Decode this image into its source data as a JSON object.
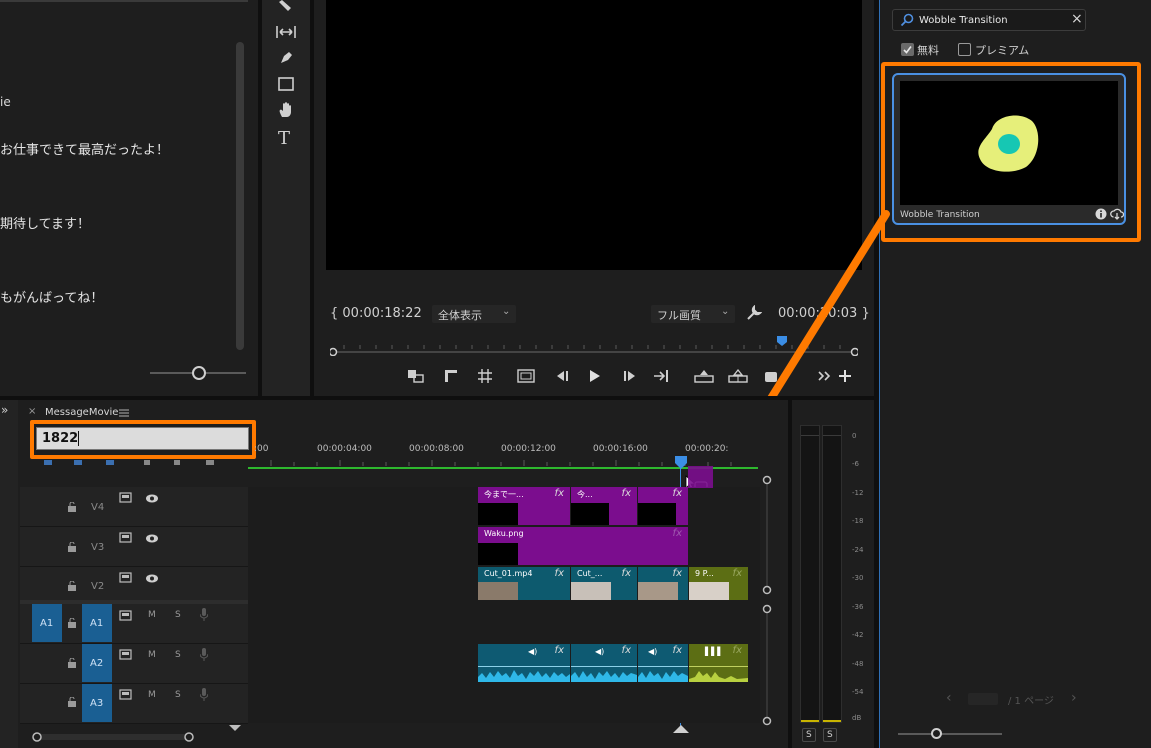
{
  "chat_text": {
    "line1": "ie",
    "line2": "お仕事できて最高だったよ！",
    "line3": "期待してます！",
    "line4": "もがんばってね！"
  },
  "program_monitor": {
    "timecode_left": "{ 00:00:18:22",
    "fit_label": "全体表示",
    "quality_label": "フル画質",
    "timecode_right": "00:00:20:03 }"
  },
  "effects_panel": {
    "search_value": "Wobble Transition",
    "free_checkbox_label": "無料",
    "premium_checkbox_label": "プレミアム",
    "result_title": "Wobble Transition",
    "page_label": "/ 1 ページ",
    "free_checked": true,
    "premium_checked": false
  },
  "timeline": {
    "sequence_name": "MessageMovie",
    "timecode_input": "1822",
    "ruler_labels": [
      ":00",
      "00:00:04:00",
      "00:00:08:00",
      "00:00:12:00",
      "00:00:16:00",
      "00:00:20:"
    ],
    "tracks": {
      "v4": "V4",
      "v3": "V3",
      "v2": "V2",
      "a1_src": "A1",
      "a1": "A1",
      "a2": "A2",
      "a3": "A3",
      "mute": "M",
      "solo": "S"
    },
    "clips": {
      "v4_a": "今まで一...",
      "v4_b": "今...",
      "v3": "Waku.png",
      "v2_a": "Cut_01.mp4",
      "v2_b": "Cut_...",
      "v2_c": "9 P...",
      "fx": "fx"
    }
  },
  "audio_meter": {
    "ticks": [
      "0",
      "-6",
      "-12",
      "-18",
      "-24",
      "-30",
      "-36",
      "-42",
      "-48",
      "-54",
      "dB"
    ],
    "solo_left": "S",
    "solo_right": "S"
  },
  "colors": {
    "highlight_orange": "#ff7a00",
    "purple_clip": "#7b0d8e",
    "teal_clip": "#0d5a6e",
    "audio_teal": "#0e5a72",
    "green_clip": "#5c6e14",
    "playhead_blue": "#3b8ee6",
    "track_blue": "#1a5f93"
  }
}
